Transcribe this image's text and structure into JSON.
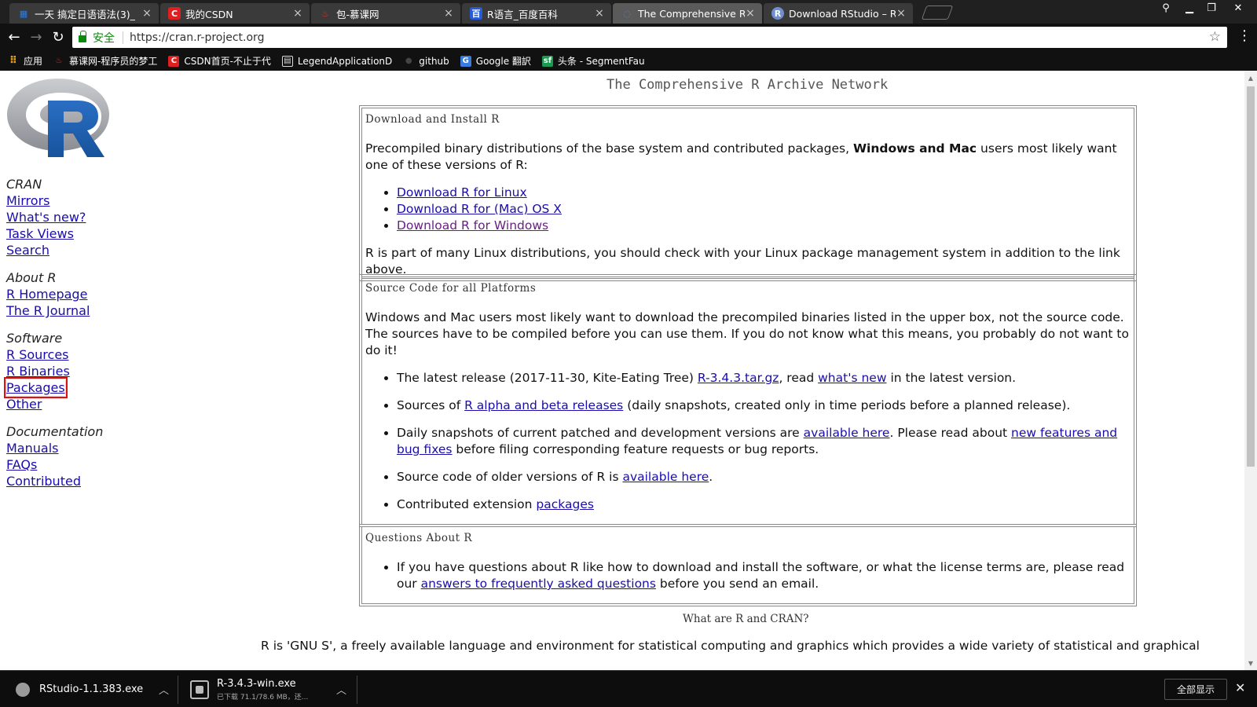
{
  "browser": {
    "tabs": [
      {
        "title": "一天 搞定日语语法(3)_",
        "icon": "calendar-icon",
        "color": "#2a7de1"
      },
      {
        "title": "我的CSDN",
        "icon": "csdn-icon",
        "color": "#e02020"
      },
      {
        "title": "包-慕课网",
        "icon": "flame-icon",
        "color": "#e03020"
      },
      {
        "title": "R语言_百度百科",
        "icon": "baidu-icon",
        "color": "#2a5bd7"
      },
      {
        "title": "The Comprehensive R",
        "icon": "r-icon",
        "color": "#5a7fb5"
      },
      {
        "title": "Download RStudio – R",
        "icon": "rstudio-icon",
        "color": "#6f8fd0"
      }
    ],
    "active_tab": 4,
    "address": {
      "secure_label": "安全",
      "url": "https://cran.r-project.org"
    },
    "bookmarks": [
      {
        "label": "应用",
        "icon": "apps-grid-icon",
        "color": "#e8a020"
      },
      {
        "label": "慕课网-程序员的梦工",
        "icon": "flame-icon",
        "color": "#e03020"
      },
      {
        "label": "CSDN首页-不止于代",
        "icon": "csdn-icon",
        "color": "#e02020"
      },
      {
        "label": "LegendApplicationD",
        "icon": "app-icon",
        "color": "#dddddd"
      },
      {
        "label": "github",
        "icon": "github-icon",
        "color": "#222222"
      },
      {
        "label": "Google 翻訳",
        "icon": "translate-icon",
        "color": "#3a7be0"
      },
      {
        "label": "头条 - SegmentFau",
        "icon": "sf-icon",
        "color": "#1a9a50"
      }
    ]
  },
  "sidebar": {
    "sections": [
      {
        "title": "CRAN",
        "links": [
          "Mirrors",
          "What's new?",
          "Task Views",
          "Search"
        ]
      },
      {
        "title": "About R",
        "links": [
          "R Homepage",
          "The R Journal"
        ]
      },
      {
        "title": "Software",
        "links": [
          "R Sources",
          "R Binaries",
          "Packages",
          "Other"
        ]
      },
      {
        "title": "Documentation",
        "links": [
          "Manuals",
          "FAQs",
          "Contributed"
        ]
      }
    ]
  },
  "main": {
    "title": "The Comprehensive R Archive Network",
    "box1": {
      "heading": "Download and Install R",
      "intro_a": "Precompiled binary distributions of the base system and contributed packages, ",
      "intro_b": "Windows and Mac",
      "intro_c": " users most likely want one of these versions of R:",
      "links": [
        "Download R for Linux",
        "Download R for (Mac) OS X",
        "Download R for Windows"
      ],
      "outro": "R is part of many Linux distributions, you should check with your Linux package management system in addition to the link above."
    },
    "box2": {
      "heading": "Source Code for all Platforms",
      "intro": "Windows and Mac users most likely want to download the precompiled binaries listed in the upper box, not the source code. The sources have to be compiled before you can use them. If you do not know what this means, you probably do not want to do it!",
      "item1_a": "The latest release (2017-11-30, Kite-Eating Tree) ",
      "item1_link1": "R-3.4.3.tar.gz",
      "item1_b": ", read ",
      "item1_link2": "what's new",
      "item1_c": " in the latest version.",
      "item2_a": "Sources of ",
      "item2_link": "R alpha and beta releases",
      "item2_b": " (daily snapshots, created only in time periods before a planned release).",
      "item3_a": "Daily snapshots of current patched and development versions are ",
      "item3_link1": "available here",
      "item3_b": ". Please read about ",
      "item3_link2": "new features and bug fixes",
      "item3_c": " before filing corresponding feature requests or bug reports.",
      "item4_a": "Source code of older versions of R is ",
      "item4_link": "available here",
      "item4_b": ".",
      "item5_a": "Contributed extension ",
      "item5_link": "packages"
    },
    "box3": {
      "heading": "Questions About R",
      "item_a": "If you have questions about R like how to download and install the software, or what the license terms are, please read our ",
      "item_link": "answers to frequently asked questions",
      "item_b": " before you send an email."
    },
    "what_title": "What are R and CRAN?",
    "bottom_text": "R is 'GNU S', a freely available language and environment for statistical computing and graphics which provides a wide variety of statistical and graphical"
  },
  "downloads": [
    {
      "name": "RStudio-1.1.383.exe",
      "sub": ""
    },
    {
      "name": "R-3.4.3-win.exe",
      "sub": "已下载 71.1/78.6 MB，还..."
    }
  ],
  "download_bar": {
    "show_all": "全部显示"
  },
  "colors": {
    "link": "#1a0dab",
    "visited": "#6b1f86",
    "highlight": "#dd1111",
    "r_blue": "#1f62b3"
  }
}
